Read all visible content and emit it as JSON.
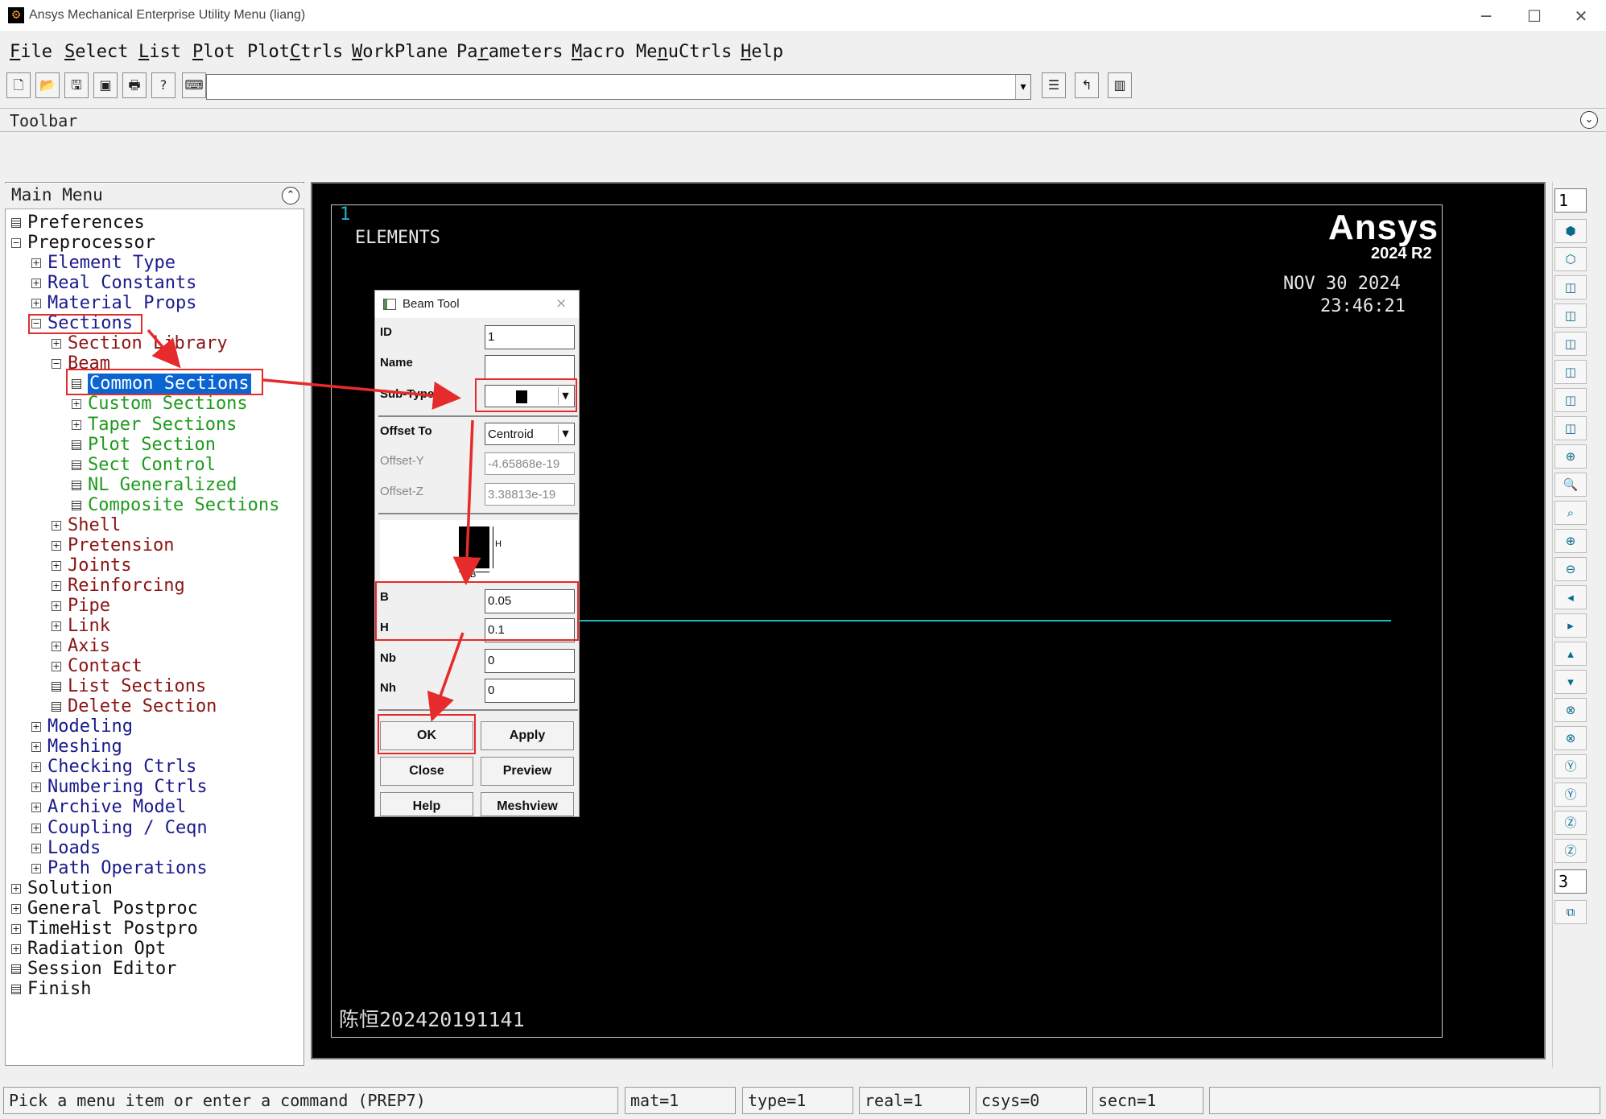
{
  "window": {
    "title": "Ansys Mechanical Enterprise Utility Menu (liang)",
    "minimize": "─",
    "maximize": "☐",
    "close": "✕"
  },
  "menubar": {
    "items": [
      {
        "first": "F",
        "rest": "ile"
      },
      {
        "first": "S",
        "rest": "elect"
      },
      {
        "first": "L",
        "rest": "ist"
      },
      {
        "first": "P",
        "rest": "lot"
      },
      {
        "first": "",
        "pre": "Plot",
        "u": "C",
        "post": "trls"
      },
      {
        "first": "W",
        "rest": "orkPlane"
      },
      {
        "first": "",
        "pre": "Pa",
        "u": "r",
        "post": "ameters"
      },
      {
        "first": "M",
        "rest": "acro"
      },
      {
        "first": "",
        "pre": "Me",
        "u": "n",
        "post": "uCtrls"
      },
      {
        "first": "H",
        "rest": "elp"
      }
    ]
  },
  "command": {
    "value": "",
    "dropdown": "▾"
  },
  "toolbar_label": "Toolbar",
  "main_menu": {
    "title": "Main Menu",
    "rows": [
      {
        "label": "Preferences",
        "icon": "func",
        "color": "black",
        "level": 0
      },
      {
        "label": "Preprocessor",
        "icon": "minus",
        "color": "black",
        "level": 0
      },
      {
        "label": "Element Type",
        "icon": "plus",
        "color": "blue",
        "level": 1
      },
      {
        "label": "Real Constants",
        "icon": "plus",
        "color": "blue",
        "level": 1
      },
      {
        "label": "Material Props",
        "icon": "plus",
        "color": "blue",
        "level": 1
      },
      {
        "label": "Sections",
        "icon": "minus",
        "color": "blue",
        "level": 1
      },
      {
        "label": "Section Library",
        "icon": "plus",
        "color": "red",
        "level": 2
      },
      {
        "label": "Beam",
        "icon": "minus",
        "color": "red",
        "level": 2
      },
      {
        "label": "Common Sections",
        "icon": "func",
        "color": "sel",
        "level": 3
      },
      {
        "label": "Custom Sections",
        "icon": "plus",
        "color": "green",
        "level": 3
      },
      {
        "label": "Taper Sections",
        "icon": "plus",
        "color": "green",
        "level": 3
      },
      {
        "label": "Plot Section",
        "icon": "func",
        "color": "green",
        "level": 3
      },
      {
        "label": "Sect Control",
        "icon": "func",
        "color": "green",
        "level": 3
      },
      {
        "label": "NL Generalized",
        "icon": "func",
        "color": "green",
        "level": 3
      },
      {
        "label": "Composite Sections",
        "icon": "func",
        "color": "green",
        "level": 3
      },
      {
        "label": "Shell",
        "icon": "plus",
        "color": "red",
        "level": 2
      },
      {
        "label": "Pretension",
        "icon": "plus",
        "color": "red",
        "level": 2
      },
      {
        "label": "Joints",
        "icon": "plus",
        "color": "red",
        "level": 2
      },
      {
        "label": "Reinforcing",
        "icon": "plus",
        "color": "red",
        "level": 2
      },
      {
        "label": "Pipe",
        "icon": "plus",
        "color": "red",
        "level": 2
      },
      {
        "label": "Link",
        "icon": "plus",
        "color": "red",
        "level": 2
      },
      {
        "label": "Axis",
        "icon": "plus",
        "color": "red",
        "level": 2
      },
      {
        "label": "Contact",
        "icon": "plus",
        "color": "red",
        "level": 2
      },
      {
        "label": "List Sections",
        "icon": "func",
        "color": "red",
        "level": 2
      },
      {
        "label": "Delete Section",
        "icon": "func",
        "color": "red",
        "level": 2
      },
      {
        "label": "Modeling",
        "icon": "plus",
        "color": "blue",
        "level": 1
      },
      {
        "label": "Meshing",
        "icon": "plus",
        "color": "blue",
        "level": 1
      },
      {
        "label": "Checking Ctrls",
        "icon": "plus",
        "color": "blue",
        "level": 1
      },
      {
        "label": "Numbering Ctrls",
        "icon": "plus",
        "color": "blue",
        "level": 1
      },
      {
        "label": "Archive Model",
        "icon": "plus",
        "color": "blue",
        "level": 1
      },
      {
        "label": "Coupling / Ceqn",
        "icon": "plus",
        "color": "blue",
        "level": 1
      },
      {
        "label": "Loads",
        "icon": "plus",
        "color": "blue",
        "level": 1
      },
      {
        "label": "Path Operations",
        "icon": "plus",
        "color": "blue",
        "level": 1
      },
      {
        "label": "Solution",
        "icon": "plus",
        "color": "black",
        "level": 0
      },
      {
        "label": "General Postproc",
        "icon": "plus",
        "color": "black",
        "level": 0
      },
      {
        "label": "TimeHist Postpro",
        "icon": "plus",
        "color": "black",
        "level": 0
      },
      {
        "label": "Radiation Opt",
        "icon": "plus",
        "color": "black",
        "level": 0
      },
      {
        "label": "Session Editor",
        "icon": "func",
        "color": "black",
        "level": 0
      },
      {
        "label": "Finish",
        "icon": "func",
        "color": "black",
        "level": 0
      }
    ]
  },
  "graphics": {
    "window_number": "1",
    "label": "ELEMENTS",
    "logo": "Ansys",
    "version": "2024 R2",
    "date": "NOV 30 2024",
    "time": "23:46:21",
    "watermark": "陈恒202420191141"
  },
  "beam_tool": {
    "title": "Beam Tool",
    "id_label": "ID",
    "id_value": "1",
    "name_label": "Name",
    "name_value": "",
    "subtype_label": "Sub-Type",
    "offset_label": "Offset To",
    "offset_value": "Centroid",
    "offset_y_label": "Offset-Y",
    "offset_y_value": "-4.65868e-19",
    "offset_z_label": "Offset-Z",
    "offset_z_value": "3.38813e-19",
    "b_label": "B",
    "b_value": "0.05",
    "h_label": "H",
    "h_value": "0.1",
    "nb_label": "Nb",
    "nb_value": "0",
    "nh_label": "Nh",
    "nh_value": "0",
    "diagram_h": "H",
    "diagram_b": "B",
    "ok": "OK",
    "apply": "Apply",
    "close": "Close",
    "preview": "Preview",
    "help": "Help",
    "meshview": "Meshview"
  },
  "right_strip": {
    "top_select": "1",
    "mid_select": "3"
  },
  "status": {
    "prompt": "Pick a menu item or enter a command (PREP7)",
    "mat": "mat=1",
    "type": "type=1",
    "real": "real=1",
    "csys": "csys=0",
    "secn": "secn=1"
  },
  "colors": {
    "annotation": "#e52b2b",
    "selection": "#0a64d2",
    "element_line": "#1fb7c4"
  }
}
